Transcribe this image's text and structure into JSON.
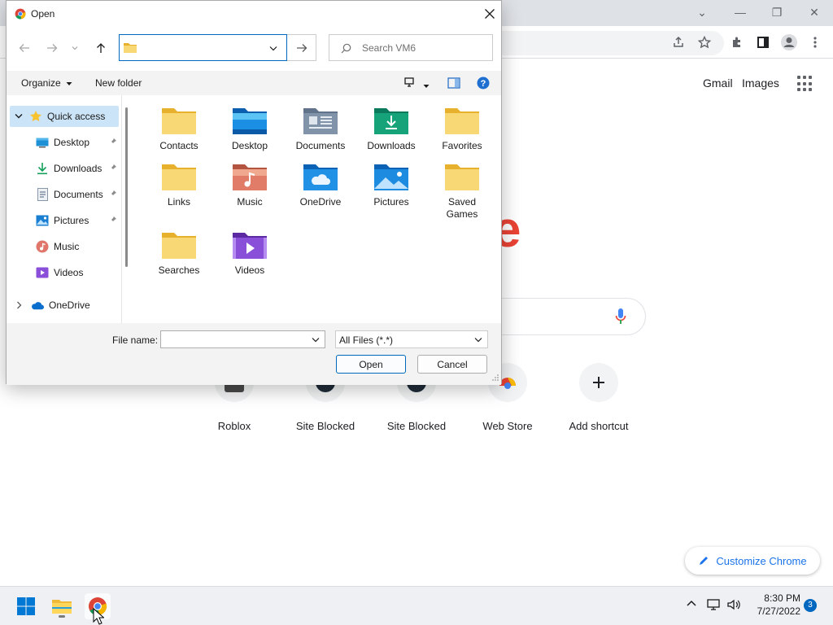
{
  "browser": {
    "header_links": {
      "gmail": "Gmail",
      "images": "Images"
    },
    "logo_fragment": "e",
    "shortcuts": [
      {
        "label": "Roblox"
      },
      {
        "label": "Site Blocked"
      },
      {
        "label": "Site Blocked"
      },
      {
        "label": "Web Store"
      },
      {
        "label": "Add shortcut"
      }
    ],
    "customize_label": "Customize Chrome"
  },
  "dialog": {
    "title": "Open",
    "address_value": "",
    "search_placeholder": "Search VM6",
    "toolbar": {
      "organize": "Organize",
      "new_folder": "New folder"
    },
    "nav": {
      "quick_access": "Quick access",
      "items": [
        {
          "label": "Desktop"
        },
        {
          "label": "Downloads"
        },
        {
          "label": "Documents"
        },
        {
          "label": "Pictures"
        },
        {
          "label": "Music"
        },
        {
          "label": "Videos"
        }
      ],
      "onedrive": "OneDrive"
    },
    "folders": [
      {
        "name": "Contacts",
        "icon": "folder-icon"
      },
      {
        "name": "Desktop",
        "icon": "desktop-folder-icon"
      },
      {
        "name": "Documents",
        "icon": "documents-folder-icon"
      },
      {
        "name": "Downloads",
        "icon": "downloads-folder-icon"
      },
      {
        "name": "Favorites",
        "icon": "folder-icon"
      },
      {
        "name": "Links",
        "icon": "folder-icon"
      },
      {
        "name": "Music",
        "icon": "music-folder-icon"
      },
      {
        "name": "OneDrive",
        "icon": "onedrive-folder-icon"
      },
      {
        "name": "Pictures",
        "icon": "pictures-folder-icon"
      },
      {
        "name": "Saved Games",
        "icon": "folder-icon"
      },
      {
        "name": "Searches",
        "icon": "folder-icon"
      },
      {
        "name": "Videos",
        "icon": "videos-folder-icon"
      }
    ],
    "file_name_label": "File name:",
    "file_name_value": "",
    "file_type": "All Files (*.*)",
    "open_button": "Open",
    "cancel_button": "Cancel"
  },
  "taskbar": {
    "time": "8:30 PM",
    "date": "7/27/2022",
    "notification_count": "3"
  },
  "colors": {
    "accent": "#0067c0",
    "folder_yellow": "#f8d775",
    "selection": "#cce4f7"
  }
}
